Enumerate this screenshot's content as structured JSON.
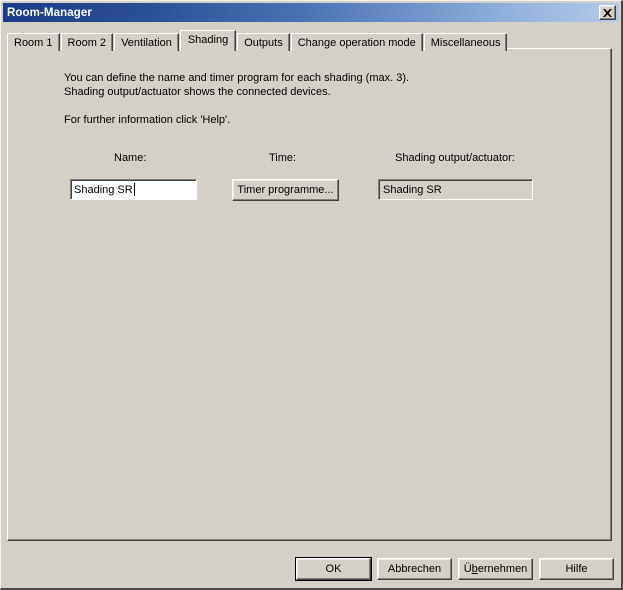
{
  "window": {
    "title": "Room-Manager",
    "close_icon": "close-x-icon",
    "titlebar_gradient_start": "#1c3b86",
    "titlebar_gradient_end": "#b3cae8",
    "face_color": "#d4d0c8"
  },
  "tabs": [
    {
      "label": "Room 1",
      "selected": false
    },
    {
      "label": "Room 2",
      "selected": false
    },
    {
      "label": "Ventilation",
      "selected": false
    },
    {
      "label": "Shading",
      "selected": true
    },
    {
      "label": "Outputs",
      "selected": false
    },
    {
      "label": "Change operation mode",
      "selected": false
    },
    {
      "label": "Miscellaneous",
      "selected": false
    }
  ],
  "panel": {
    "description_line1": "You can define the name and timer program for each shading (max. 3).",
    "description_line2": "Shading output/actuator shows the connected devices.",
    "description_line3": "For further information click 'Help'.",
    "labels": {
      "name": "Name:",
      "time": "Time:",
      "output": "Shading output/actuator:"
    },
    "name_input": {
      "value": "Shading SR",
      "placeholder": ""
    },
    "timer_button": {
      "label": "Timer programme..."
    },
    "output_field": {
      "value": "Shading SR"
    }
  },
  "footer": {
    "ok": "OK",
    "cancel": "Abbrechen",
    "apply_prefix": "Ü",
    "apply_accel": "b",
    "apply_suffix": "ernehmen",
    "help": "Hilfe"
  }
}
